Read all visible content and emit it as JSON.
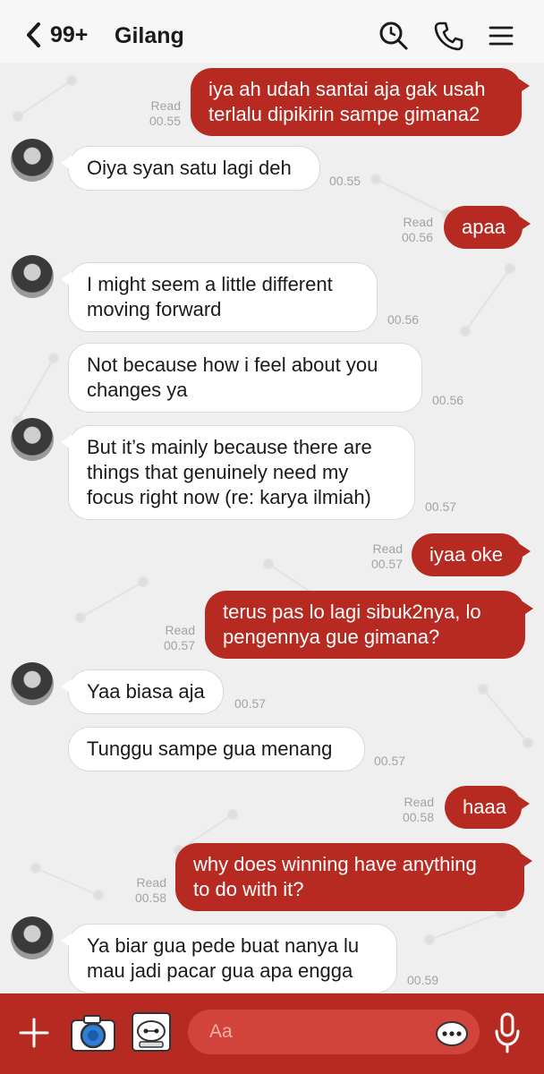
{
  "header": {
    "back_count": "99+",
    "title": "Gilang",
    "icons": [
      "search-icon",
      "phone-icon",
      "menu-icon"
    ]
  },
  "messages": [
    {
      "from": "me",
      "text": "iya ah udah santai aja gak usah\nterlalu dipikirin sampe gimana2",
      "status": "Read",
      "time": "00.55"
    },
    {
      "from": "Gilang",
      "text": "Oiya syan satu lagi deh",
      "time": "00.55"
    },
    {
      "from": "me",
      "text": "apaa",
      "status": "Read",
      "time": "00.56"
    },
    {
      "from": "Gilang",
      "text": "I might seem a little different\nmoving forward",
      "time": "00.56"
    },
    {
      "from": "Gilang",
      "text": "Not because how i feel about you\nchanges ya",
      "time": "00.56"
    },
    {
      "from": "Gilang",
      "text": "But it’s mainly because there are\nthings that genuinely need my\nfocus right now (re: karya ilmiah)",
      "time": "00.57"
    },
    {
      "from": "me",
      "text": "iyaa oke",
      "status": "Read",
      "time": "00.57"
    },
    {
      "from": "me",
      "text": "terus pas lo lagi sibuk2nya, lo\npengennya gue gimana?",
      "status": "Read",
      "time": "00.57"
    },
    {
      "from": "Gilang",
      "text": "Yaa biasa aja",
      "time": "00.57"
    },
    {
      "from": "Gilang",
      "text": "Tunggu sampe gua menang",
      "time": "00.57"
    },
    {
      "from": "me",
      "text": "haaa",
      "status": "Read",
      "time": "00.58"
    },
    {
      "from": "me",
      "text": "why does winning have anything\nto do with it?",
      "status": "Read",
      "time": "00.58"
    },
    {
      "from": "Gilang",
      "text": "Ya biar gua pede buat nanya lu\nmau jadi pacar gua apa engga",
      "time": "00.59"
    }
  ],
  "composer": {
    "placeholder": "Aa",
    "icons": [
      "plus-icon",
      "camera-icon",
      "sticker-icon",
      "emoji-icon",
      "microphone-icon"
    ]
  },
  "colors": {
    "accent": "#b72a22",
    "chat_bg": "#efefef",
    "incoming_bubble": "#ffffff"
  }
}
